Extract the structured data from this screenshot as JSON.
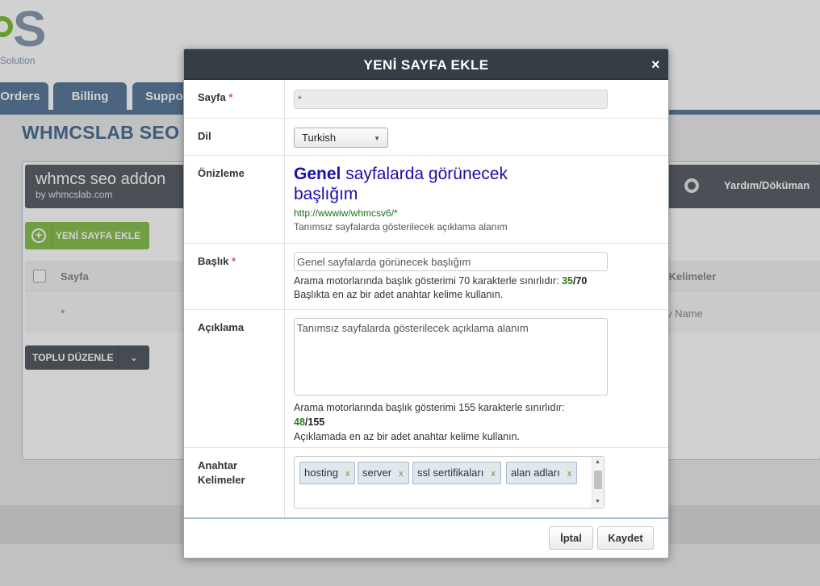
{
  "logo": {
    "text": "Solution"
  },
  "nav": {
    "orders": "Orders",
    "billing": "Billing",
    "support": "Support"
  },
  "page": {
    "title": "WHMCSLAB SEO"
  },
  "addon": {
    "name": "whmcs seo addon",
    "by": "by whmcslab.com",
    "help_label": "Yardım/Döküman",
    "add_page_label": "YENİ SAYFA EKLE",
    "bulk_edit_label": "TOPLU DÜZENLE"
  },
  "table": {
    "headers": {
      "page": "Sayfa",
      "keywords": "r Kelimeler"
    },
    "row": {
      "page": "*",
      "keywords": "y Name"
    }
  },
  "modal": {
    "title": "YENİ SAYFA EKLE",
    "close": "×",
    "fields": {
      "page": {
        "label": "Sayfa",
        "required": "*",
        "value": "*"
      },
      "language": {
        "label": "Dil",
        "value": "Turkish"
      },
      "preview": {
        "label": "Önizleme",
        "title_bold": "Genel",
        "title_rest": " sayfalarda görünecek başlığım",
        "url": "http://wwwiw/whmcsv6/*",
        "desc": "Tanımsız sayfalarda gösterilecek açıklama alanım"
      },
      "title": {
        "label": "Başlık",
        "required": "*",
        "value": "Genel sayfalarda görünecek başlığım",
        "help1": "Arama motorlarında başlık gösterimi 70 karakterle sınırlıdır: ",
        "count": "35",
        "sep": "/",
        "max": "70",
        "help2": "Başlıkta en az bir adet anahtar kelime kullanın."
      },
      "description": {
        "label": "Açıklama",
        "value": "Tanımsız sayfalarda gösterilecek açıklama alanım",
        "help1": "Arama motorlarında başlık gösterimi 155 karakterle sınırlıdır:",
        "count": "48",
        "sep": "/",
        "max": "155",
        "help2": "Açıklamada en az bir adet anahtar kelime kullanın."
      },
      "keywords": {
        "label_line1": "Anahtar",
        "label_line2": "Kelimeler",
        "tags": [
          "hosting",
          "server",
          "ssl sertifikaları",
          "alan adları"
        ],
        "remove": "x"
      }
    },
    "buttons": {
      "cancel": "İptal",
      "save": "Kaydet"
    }
  }
}
